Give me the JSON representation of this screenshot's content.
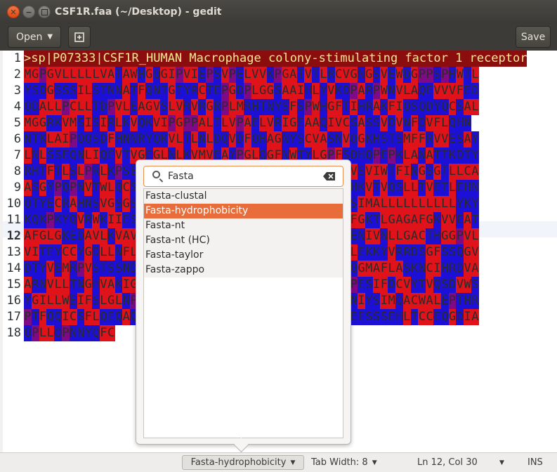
{
  "window": {
    "title": "CSF1R.faa (~/Desktop) - gedit"
  },
  "header": {
    "open_label": "Open",
    "save_label": "Save"
  },
  "colors": {
    "hydrophobic": "#e0131b",
    "hydrophilic": "#1c10d6",
    "neutral": "#7f0a85",
    "header_bg": "#8b0d0d",
    "header_fg": "#f2ea93",
    "accent": "#e86d3a"
  },
  "editor": {
    "current_line": 12,
    "line_numbers": [
      "1",
      "2",
      "3",
      "4",
      "5",
      "6",
      "7",
      "8",
      "9",
      "10",
      "11",
      "12",
      "13",
      "14",
      "15",
      "16",
      "17",
      "18"
    ],
    "lines": [
      ">sp|P07333|CSF1R_HUMAN Macrophage colony-stimulating factor 1 receptor",
      "MGPGVLLLLLVATAWHGQGIPVIEPSVPELVVKPGATVTLRCVGNGSVEWDGPPSPHWTL",
      "YSDGSSSILSTNNATFQNTGTYRCTEPGDPLGGSAAIHLYVKDPARPWNVLAQEVVVFED",
      "QDALLPCLLTDPVLEAGVSLVRVRGRPLMRHTNYSFSPWHGFTIHRAKFIQSQDYQCSAL",
      "MGGRKVMSISIRLKVQKVIPGPPALTLVPAELVRIGEAAQIVCSASSVDVNFDVFLQHN",
      "NTKLAIPQQSDFHNNRYQKVLTLNLDQVDFQHAGNYSCVASNVQGKHSTSMFFRVVESAY",
      "LNLSSEQNLIQEVTVGEGLNLKVMVEAYPGLQGFNWTYLGPFSDHQPEPKLANATTKDTY",
      "RHTFTLSLPRLKPSEAGRYSFLARNPGGWRALTFELTLRYPPEVSVIWTFINGSGTLLCA",
      "ASGYPQPNVTWLQCSGHTDRCDEAQVLQVWDDPYPEVLSQEPFHKVTVQSLLTVETLEHN",
      "QTYECRAHNSVGSGSWAFIPISAGAHTHPPDEFLFTPVVVACMSIMALLLLLLLLLLYKY",
      "KQKPKYQVRWKIIESYEGNSYTFIDPTQLPYNEKWEFPRNNLQFGKTLGAGAFGKVVEAT",
      "AFGLGKEDAVLKVAVKMLKSTAHADEKEALMSELKIMSHLGQHENIVNLLGACTHGGPVL",
      "VITEYCCYGDLLNFLRRKAEAMLGPSLSPGQDPEGGVDYKNIHLEKKYVRRDSGFSSQGV",
      "DTYVEMRPVSTSSNDSFSEQDLDKEDGRPLELRDLLHFSSQVAQGMAFLASKNCIHRDVA",
      "ARNVLLTNGHVAKIGDFGLARDIMNDSNYIVKGNARLPVKWMAPESIFDCVYTVQSDVWS",
      "YGILLWEIFSLGLNPYPGILVNSKFYKLVKDGYQMAQPAFAPKNIYSIMQACWALEPTHR",
      "PTFQQICSFLQEQAQEDRRERDYTNLPSSSRSGGSGSSSSELEEESSSEHLTCCEQGDIA",
      "QPLLQPNNYQFC"
    ]
  },
  "language_popover": {
    "search_value": "Fasta",
    "items": [
      "Fasta-clustal",
      "Fasta-hydrophobicity",
      "Fasta-nt",
      "Fasta-nt (HC)",
      "Fasta-taylor",
      "Fasta-zappo"
    ],
    "selected_index": 1
  },
  "statusbar": {
    "language": "Fasta-hydrophobicity",
    "tab_width": "Tab Width: 8",
    "position": "Ln 12, Col 30",
    "mode": "INS"
  }
}
